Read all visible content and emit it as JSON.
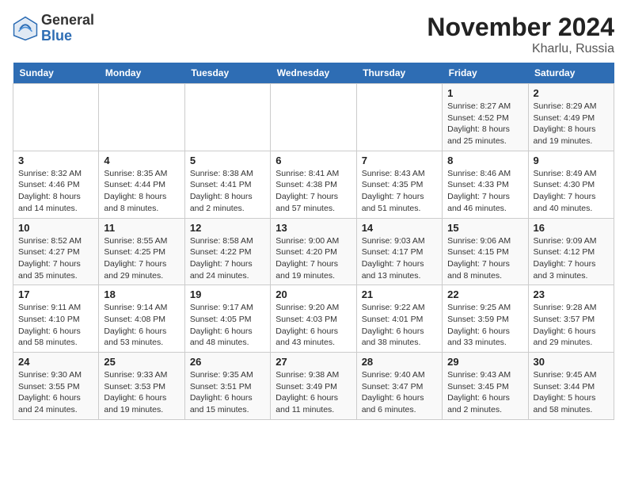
{
  "app": {
    "logo_general": "General",
    "logo_blue": "Blue"
  },
  "header": {
    "month_title": "November 2024",
    "location": "Kharlu, Russia"
  },
  "weekdays": [
    "Sunday",
    "Monday",
    "Tuesday",
    "Wednesday",
    "Thursday",
    "Friday",
    "Saturday"
  ],
  "weeks": [
    [
      {
        "day": "",
        "info": ""
      },
      {
        "day": "",
        "info": ""
      },
      {
        "day": "",
        "info": ""
      },
      {
        "day": "",
        "info": ""
      },
      {
        "day": "",
        "info": ""
      },
      {
        "day": "1",
        "info": "Sunrise: 8:27 AM\nSunset: 4:52 PM\nDaylight: 8 hours and 25 minutes."
      },
      {
        "day": "2",
        "info": "Sunrise: 8:29 AM\nSunset: 4:49 PM\nDaylight: 8 hours and 19 minutes."
      }
    ],
    [
      {
        "day": "3",
        "info": "Sunrise: 8:32 AM\nSunset: 4:46 PM\nDaylight: 8 hours and 14 minutes."
      },
      {
        "day": "4",
        "info": "Sunrise: 8:35 AM\nSunset: 4:44 PM\nDaylight: 8 hours and 8 minutes."
      },
      {
        "day": "5",
        "info": "Sunrise: 8:38 AM\nSunset: 4:41 PM\nDaylight: 8 hours and 2 minutes."
      },
      {
        "day": "6",
        "info": "Sunrise: 8:41 AM\nSunset: 4:38 PM\nDaylight: 7 hours and 57 minutes."
      },
      {
        "day": "7",
        "info": "Sunrise: 8:43 AM\nSunset: 4:35 PM\nDaylight: 7 hours and 51 minutes."
      },
      {
        "day": "8",
        "info": "Sunrise: 8:46 AM\nSunset: 4:33 PM\nDaylight: 7 hours and 46 minutes."
      },
      {
        "day": "9",
        "info": "Sunrise: 8:49 AM\nSunset: 4:30 PM\nDaylight: 7 hours and 40 minutes."
      }
    ],
    [
      {
        "day": "10",
        "info": "Sunrise: 8:52 AM\nSunset: 4:27 PM\nDaylight: 7 hours and 35 minutes."
      },
      {
        "day": "11",
        "info": "Sunrise: 8:55 AM\nSunset: 4:25 PM\nDaylight: 7 hours and 29 minutes."
      },
      {
        "day": "12",
        "info": "Sunrise: 8:58 AM\nSunset: 4:22 PM\nDaylight: 7 hours and 24 minutes."
      },
      {
        "day": "13",
        "info": "Sunrise: 9:00 AM\nSunset: 4:20 PM\nDaylight: 7 hours and 19 minutes."
      },
      {
        "day": "14",
        "info": "Sunrise: 9:03 AM\nSunset: 4:17 PM\nDaylight: 7 hours and 13 minutes."
      },
      {
        "day": "15",
        "info": "Sunrise: 9:06 AM\nSunset: 4:15 PM\nDaylight: 7 hours and 8 minutes."
      },
      {
        "day": "16",
        "info": "Sunrise: 9:09 AM\nSunset: 4:12 PM\nDaylight: 7 hours and 3 minutes."
      }
    ],
    [
      {
        "day": "17",
        "info": "Sunrise: 9:11 AM\nSunset: 4:10 PM\nDaylight: 6 hours and 58 minutes."
      },
      {
        "day": "18",
        "info": "Sunrise: 9:14 AM\nSunset: 4:08 PM\nDaylight: 6 hours and 53 minutes."
      },
      {
        "day": "19",
        "info": "Sunrise: 9:17 AM\nSunset: 4:05 PM\nDaylight: 6 hours and 48 minutes."
      },
      {
        "day": "20",
        "info": "Sunrise: 9:20 AM\nSunset: 4:03 PM\nDaylight: 6 hours and 43 minutes."
      },
      {
        "day": "21",
        "info": "Sunrise: 9:22 AM\nSunset: 4:01 PM\nDaylight: 6 hours and 38 minutes."
      },
      {
        "day": "22",
        "info": "Sunrise: 9:25 AM\nSunset: 3:59 PM\nDaylight: 6 hours and 33 minutes."
      },
      {
        "day": "23",
        "info": "Sunrise: 9:28 AM\nSunset: 3:57 PM\nDaylight: 6 hours and 29 minutes."
      }
    ],
    [
      {
        "day": "24",
        "info": "Sunrise: 9:30 AM\nSunset: 3:55 PM\nDaylight: 6 hours and 24 minutes."
      },
      {
        "day": "25",
        "info": "Sunrise: 9:33 AM\nSunset: 3:53 PM\nDaylight: 6 hours and 19 minutes."
      },
      {
        "day": "26",
        "info": "Sunrise: 9:35 AM\nSunset: 3:51 PM\nDaylight: 6 hours and 15 minutes."
      },
      {
        "day": "27",
        "info": "Sunrise: 9:38 AM\nSunset: 3:49 PM\nDaylight: 6 hours and 11 minutes."
      },
      {
        "day": "28",
        "info": "Sunrise: 9:40 AM\nSunset: 3:47 PM\nDaylight: 6 hours and 6 minutes."
      },
      {
        "day": "29",
        "info": "Sunrise: 9:43 AM\nSunset: 3:45 PM\nDaylight: 6 hours and 2 minutes."
      },
      {
        "day": "30",
        "info": "Sunrise: 9:45 AM\nSunset: 3:44 PM\nDaylight: 5 hours and 58 minutes."
      }
    ]
  ]
}
